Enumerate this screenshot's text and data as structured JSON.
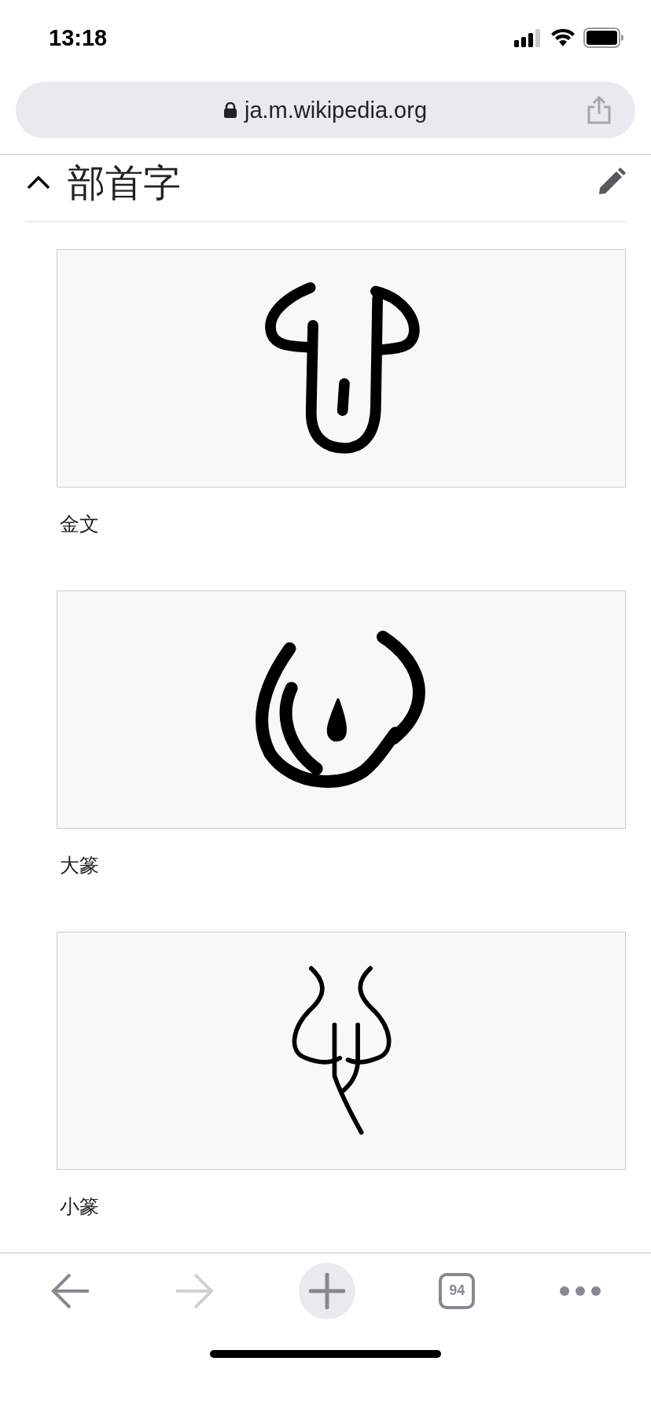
{
  "status_bar": {
    "time": "13:18"
  },
  "address_bar": {
    "url": "ja.m.wikipedia.org"
  },
  "section": {
    "title": "部首字",
    "expanded": true,
    "figures": [
      {
        "kind": "jinwen",
        "caption": "金文"
      },
      {
        "kind": "dazhuan",
        "caption": "大篆"
      },
      {
        "kind": "xiaozhuan",
        "caption": "小篆"
      }
    ]
  },
  "toolbar": {
    "back_disabled": false,
    "forward_disabled": true,
    "tab_count": "94"
  }
}
